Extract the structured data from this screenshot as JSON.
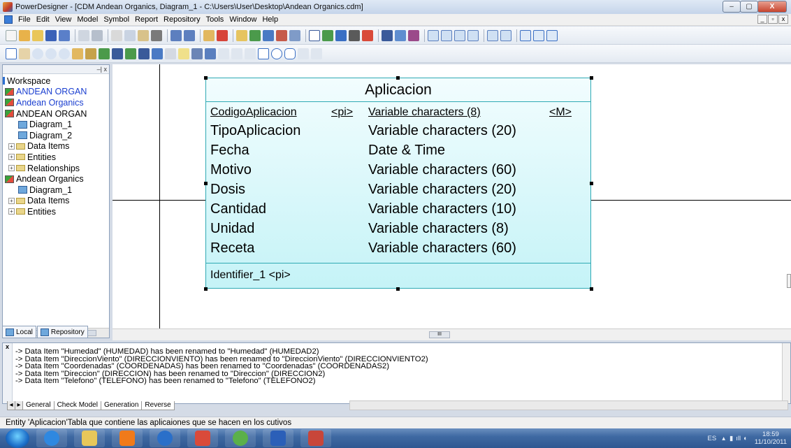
{
  "window": {
    "title": "PowerDesigner - [CDM Andean Organics, Diagram_1 - C:\\Users\\User\\Desktop\\Andean Organics.cdm]",
    "minimize_glyph": "–",
    "maximize_glyph": "▢",
    "close_glyph": "X",
    "mdi_restore_glyph": "_",
    "mdi_max_glyph": "▫",
    "mdi_close_glyph": "x"
  },
  "menu": {
    "items": [
      "File",
      "Edit",
      "View",
      "Model",
      "Symbol",
      "Report",
      "Repository",
      "Tools",
      "Window",
      "Help"
    ]
  },
  "browser": {
    "pin_glyph": "–| x",
    "tree": [
      {
        "label": "Workspace",
        "icon": "workspace-icon",
        "color": "#000000"
      },
      {
        "label": "ANDEAN ORGAN",
        "icon": "model-icon",
        "color": "#1b3fd0"
      },
      {
        "label": "Andean Organics",
        "icon": "model-icon",
        "color": "#1b3fd0"
      },
      {
        "label": "ANDEAN ORGAN",
        "icon": "model-icon",
        "color": "#000000"
      },
      {
        "label": "Diagram_1",
        "icon": "diagram-icon",
        "color": "#000000"
      },
      {
        "label": "Diagram_2",
        "icon": "diagram-icon",
        "color": "#000000"
      },
      {
        "label": "Data Items",
        "icon": "folder-icon",
        "color": "#000000"
      },
      {
        "label": "Entities",
        "icon": "folder-icon",
        "color": "#000000"
      },
      {
        "label": "Relationships",
        "icon": "folder-icon",
        "color": "#000000"
      },
      {
        "label": "Andean Organics",
        "icon": "model-icon",
        "color": "#000000"
      },
      {
        "label": "Diagram_1",
        "icon": "diagram-icon",
        "color": "#000000"
      },
      {
        "label": "Data Items",
        "icon": "folder-icon",
        "color": "#000000"
      },
      {
        "label": "Entities",
        "icon": "folder-icon",
        "color": "#000000"
      }
    ],
    "tabs": [
      "Local",
      "Repository"
    ],
    "scroll_glyph": "III"
  },
  "entity": {
    "name": "Aplicacion",
    "attributes": [
      {
        "name": "CodigoAplicacion",
        "key": "<pi>",
        "type": "Variable characters (8)",
        "mandatory": "<M>"
      },
      {
        "name": "TipoAplicacion",
        "key": "",
        "type": "Variable characters (20)",
        "mandatory": ""
      },
      {
        "name": "Fecha",
        "key": "",
        "type": "Date & Time",
        "mandatory": ""
      },
      {
        "name": "Motivo",
        "key": "",
        "type": "Variable characters (60)",
        "mandatory": ""
      },
      {
        "name": "Dosis",
        "key": "",
        "type": "Variable characters (20)",
        "mandatory": ""
      },
      {
        "name": "Cantidad",
        "key": "",
        "type": "Variable characters (10)",
        "mandatory": ""
      },
      {
        "name": "Unidad",
        "key": "",
        "type": "Variable characters (8)",
        "mandatory": ""
      },
      {
        "name": "Receta",
        "key": "",
        "type": "Variable characters (60)",
        "mandatory": ""
      }
    ],
    "identifier": "Identifier_1  <pi>"
  },
  "canvas": {
    "scroll_glyph": "III"
  },
  "output": {
    "lines": [
      "-> Data Item \"Humedad\"  (HUMEDAD) has been renamed to \"Humedad\"  (HUMEDAD2)",
      "-> Data Item \"DireccionViento\"  (DIRECCIONVIENTO) has been renamed to \"DireccionViento\"  (DIRECCIONVIENTO2)",
      "-> Data Item \"Coordenadas\"  (COORDENADAS) has been renamed to \"Coordenadas\"  (COORDENADAS2)",
      "-> Data Item \"Direccion\"  (DIRECCION) has been renamed to \"Direccion\"  (DIRECCION2)",
      "-> Data Item \"Telefono\"  (TELEFONO) has been renamed to \"Telefono\"  (TELEFONO2)"
    ],
    "tabs": [
      "General",
      "Check Model",
      "Generation",
      "Reverse"
    ],
    "close_glyph": "x"
  },
  "statusbar": {
    "text": "Entity 'Aplicacion'Tabla que contiene las aplicaiones que se hacen en los cutivos"
  },
  "taskbar": {
    "lang": "ES",
    "time": "18:59",
    "date": "11/10/2011",
    "apps": [
      {
        "icon": "internet-explorer-icon",
        "color": "#2f88e0"
      },
      {
        "icon": "file-explorer-icon",
        "color": "#e7c75a"
      },
      {
        "icon": "media-player-icon",
        "color": "#f07a1a"
      },
      {
        "icon": "hp-icon",
        "color": "#2a6fc9"
      },
      {
        "icon": "puzzle-app-icon",
        "color": "#d94a3a"
      },
      {
        "icon": "messenger-icon",
        "color": "#5bb04a"
      },
      {
        "icon": "word-icon",
        "color": "#2b5fb8"
      },
      {
        "icon": "powerdesigner-icon",
        "color": "#c8463a"
      }
    ]
  }
}
